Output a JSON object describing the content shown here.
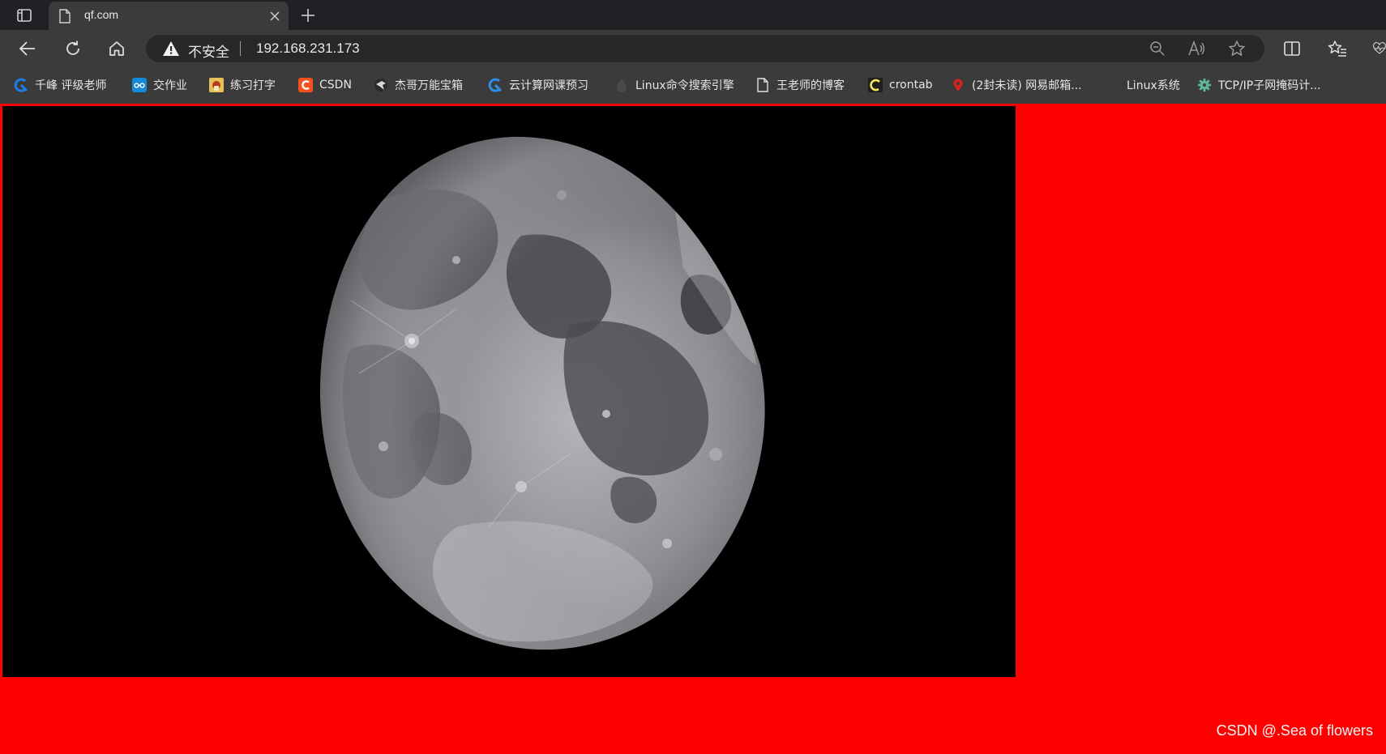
{
  "tab": {
    "title": "qf.com"
  },
  "addressbar": {
    "security_label": "不安全",
    "url": "192.168.231.173"
  },
  "bookmarks": [
    {
      "label": "千峰 评级老师",
      "icon": "qf-logo-icon"
    },
    {
      "label": "交作业",
      "icon": "link-icon"
    },
    {
      "label": "练习打字",
      "icon": "typing-icon"
    },
    {
      "label": "CSDN",
      "icon": "csdn-icon"
    },
    {
      "label": "杰哥万能宝箱",
      "icon": "eagle-icon"
    },
    {
      "label": "云计算网课预习",
      "icon": "qf-logo-icon"
    },
    {
      "label": "Linux命令搜索引擎",
      "icon": "drop-icon"
    },
    {
      "label": "王老师的博客",
      "icon": "page-icon"
    },
    {
      "label": "crontab",
      "icon": "c-icon"
    },
    {
      "label": "(2封未读) 网易邮箱...",
      "icon": "netease-icon"
    },
    {
      "label": "Linux系统",
      "icon": ""
    },
    {
      "label": "TCP/IP子网掩码计...",
      "icon": "gear-icon"
    }
  ],
  "watermark": "CSDN @.Sea of flowers",
  "colors": {
    "page_background": "#ff0000",
    "image_background": "#000000"
  }
}
